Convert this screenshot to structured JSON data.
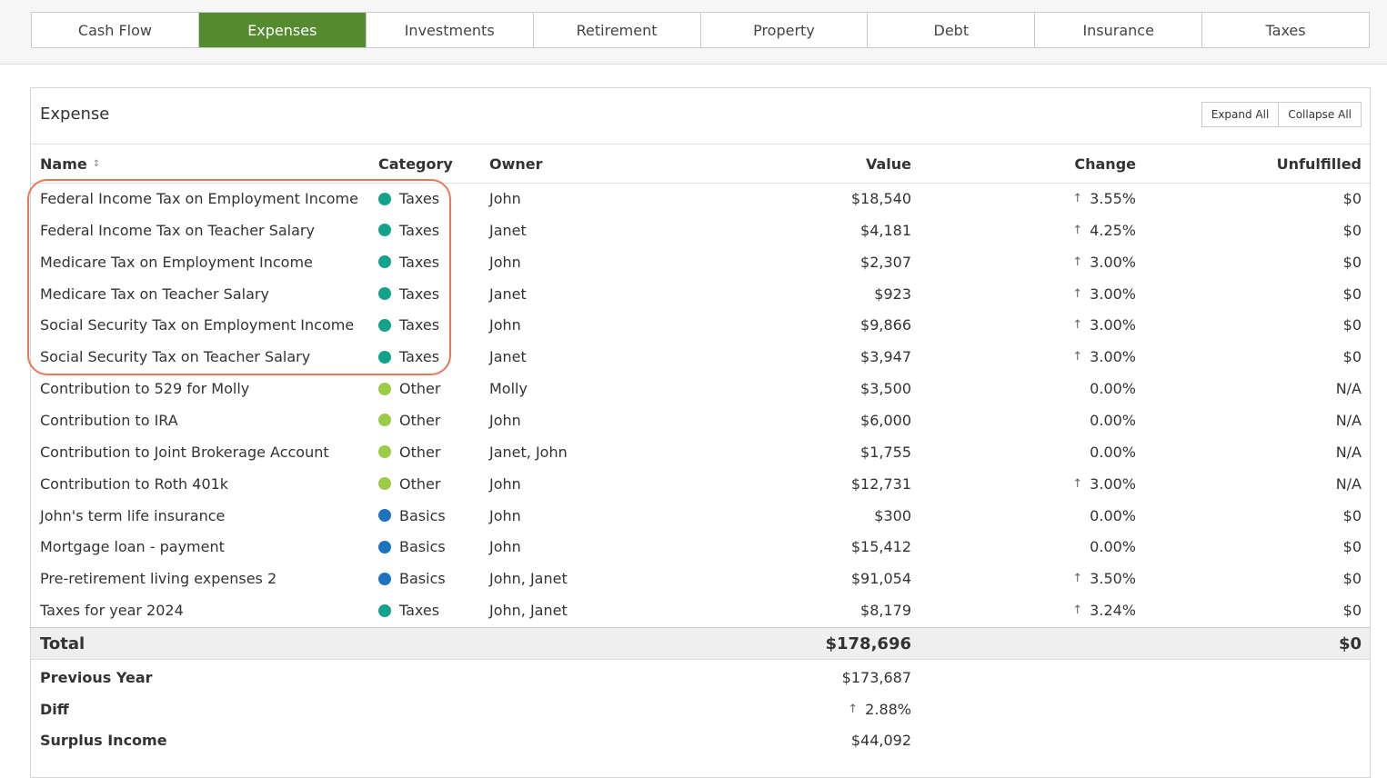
{
  "tabs": [
    {
      "label": "Cash Flow",
      "active": false
    },
    {
      "label": "Expenses",
      "active": true
    },
    {
      "label": "Investments",
      "active": false
    },
    {
      "label": "Retirement",
      "active": false
    },
    {
      "label": "Property",
      "active": false
    },
    {
      "label": "Debt",
      "active": false
    },
    {
      "label": "Insurance",
      "active": false
    },
    {
      "label": "Taxes",
      "active": false
    }
  ],
  "panel": {
    "title": "Expense",
    "expand_all": "Expand All",
    "collapse_all": "Collapse All"
  },
  "columns": {
    "name": "Name",
    "category": "Category",
    "owner": "Owner",
    "value": "Value",
    "change": "Change",
    "unfulfilled": "Unfulfilled"
  },
  "category_colors": {
    "Taxes": "#13a38a",
    "Other": "#9ccc45",
    "Basics": "#1e73be"
  },
  "rows": [
    {
      "name": "Federal Income Tax on Employment Income",
      "category": "Taxes",
      "owner": "John",
      "value": "$18,540",
      "change": "3.55%",
      "up": true,
      "unfulfilled": "$0"
    },
    {
      "name": "Federal Income Tax on Teacher Salary",
      "category": "Taxes",
      "owner": "Janet",
      "value": "$4,181",
      "change": "4.25%",
      "up": true,
      "unfulfilled": "$0"
    },
    {
      "name": "Medicare Tax on Employment Income",
      "category": "Taxes",
      "owner": "John",
      "value": "$2,307",
      "change": "3.00%",
      "up": true,
      "unfulfilled": "$0"
    },
    {
      "name": "Medicare Tax on Teacher Salary",
      "category": "Taxes",
      "owner": "Janet",
      "value": "$923",
      "change": "3.00%",
      "up": true,
      "unfulfilled": "$0"
    },
    {
      "name": "Social Security Tax on Employment Income",
      "category": "Taxes",
      "owner": "John",
      "value": "$9,866",
      "change": "3.00%",
      "up": true,
      "unfulfilled": "$0"
    },
    {
      "name": "Social Security Tax on Teacher Salary",
      "category": "Taxes",
      "owner": "Janet",
      "value": "$3,947",
      "change": "3.00%",
      "up": true,
      "unfulfilled": "$0"
    },
    {
      "name": "Contribution to 529 for Molly",
      "category": "Other",
      "owner": "Molly",
      "value": "$3,500",
      "change": "0.00%",
      "up": false,
      "unfulfilled": "N/A"
    },
    {
      "name": "Contribution to IRA",
      "category": "Other",
      "owner": "John",
      "value": "$6,000",
      "change": "0.00%",
      "up": false,
      "unfulfilled": "N/A"
    },
    {
      "name": "Contribution to Joint Brokerage Account",
      "category": "Other",
      "owner": "Janet, John",
      "value": "$1,755",
      "change": "0.00%",
      "up": false,
      "unfulfilled": "N/A"
    },
    {
      "name": "Contribution to Roth 401k",
      "category": "Other",
      "owner": "John",
      "value": "$12,731",
      "change": "3.00%",
      "up": true,
      "unfulfilled": "N/A"
    },
    {
      "name": "John's term life insurance",
      "category": "Basics",
      "owner": "John",
      "value": "$300",
      "change": "0.00%",
      "up": false,
      "unfulfilled": "$0"
    },
    {
      "name": "Mortgage loan - payment",
      "category": "Basics",
      "owner": "John",
      "value": "$15,412",
      "change": "0.00%",
      "up": false,
      "unfulfilled": "$0"
    },
    {
      "name": "Pre-retirement living expenses 2",
      "category": "Basics",
      "owner": "John, Janet",
      "value": "$91,054",
      "change": "3.50%",
      "up": true,
      "unfulfilled": "$0"
    },
    {
      "name": "Taxes for year 2024",
      "category": "Taxes",
      "owner": "John, Janet",
      "value": "$8,179",
      "change": "3.24%",
      "up": true,
      "unfulfilled": "$0"
    }
  ],
  "total": {
    "label": "Total",
    "value": "$178,696",
    "unfulfilled": "$0"
  },
  "summary": [
    {
      "label": "Previous Year",
      "value": "$173,687",
      "up": false
    },
    {
      "label": "Diff",
      "value": "2.88%",
      "up": true
    },
    {
      "label": "Surplus Income",
      "value": "$44,092",
      "up": false
    }
  ]
}
